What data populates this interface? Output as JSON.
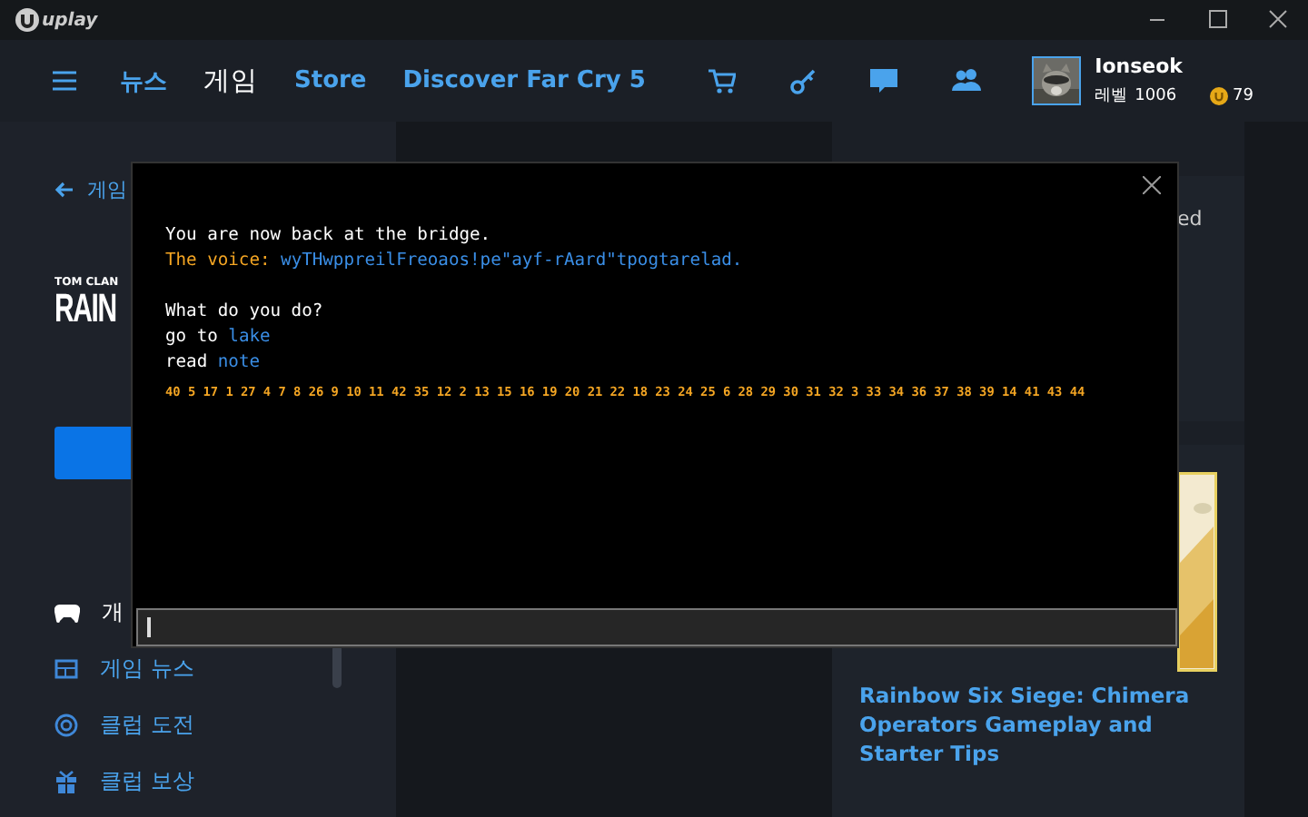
{
  "window": {
    "app_name": "uplay"
  },
  "nav": {
    "items": [
      {
        "label": "뉴스",
        "selected": false
      },
      {
        "label": "게임",
        "selected": true
      },
      {
        "label": "Store",
        "selected": false
      },
      {
        "label": "Discover Far Cry 5",
        "selected": false
      }
    ]
  },
  "profile": {
    "username": "Ionseok",
    "rank_label": "레벨",
    "rank": "1006",
    "coins": "79"
  },
  "sidebar": {
    "back_label": "게임",
    "logo": {
      "publisher": "TOM CLAN",
      "title": "RAIN"
    },
    "menu": [
      {
        "label": "개",
        "selected": true,
        "kind": "gamepad"
      },
      {
        "label": "게임 뉴스",
        "selected": false,
        "kind": "news"
      },
      {
        "label": "클럽 도전",
        "selected": false,
        "kind": "target"
      },
      {
        "label": "클럽 보상",
        "selected": false,
        "kind": "gift"
      }
    ]
  },
  "right": {
    "card_fragment": "ed",
    "news_title": "Rainbow Six Siege: Chimera Operators Gameplay and Starter Tips"
  },
  "console": {
    "lines": [
      {
        "kind": "plain",
        "text": "You are now back at the bridge."
      },
      {
        "kind": "speech",
        "speaker": "The voice:",
        "text": "wyTHwppreilFreoaos!pe\"ayf-rAard\"tpogtarelad."
      },
      {
        "kind": "blank"
      },
      {
        "kind": "plain",
        "text": "What do you do?"
      },
      {
        "kind": "choice",
        "prefix": "go to",
        "link": "lake"
      },
      {
        "kind": "choice",
        "prefix": "read",
        "link": "note"
      },
      {
        "kind": "numbers",
        "text": "40 5 17 1 27 4 7 8 26 9 10 11 42 35 12 2 13 15 16 19 20 21 22 18 23 24 25 6 28 29 30 31 32 3 33 34 36 37 38 39 14 41 43 44"
      }
    ]
  }
}
